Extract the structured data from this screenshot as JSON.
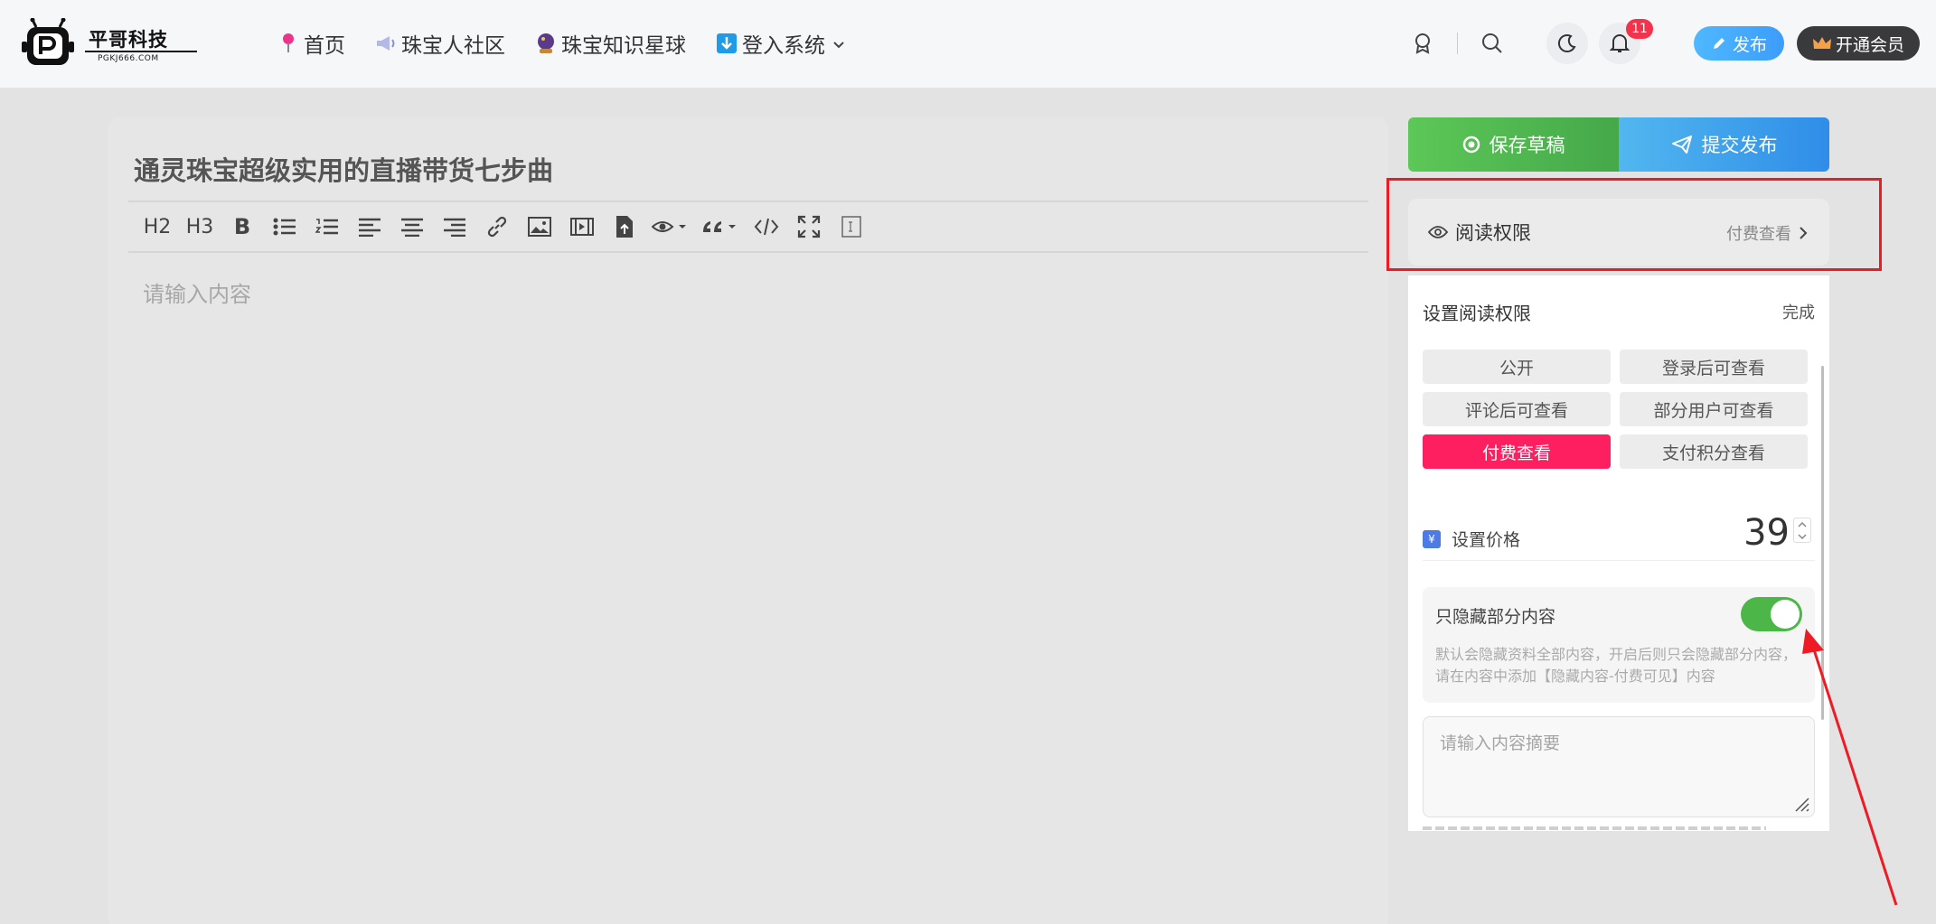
{
  "logo": {
    "name": "平哥科技",
    "sub": "PGKJ666.COM"
  },
  "nav": [
    {
      "label": "首页",
      "icon": "pin-icon"
    },
    {
      "label": "珠宝人社区",
      "icon": "megaphone-icon"
    },
    {
      "label": "珠宝知识星球",
      "icon": "crystal-ball-icon"
    },
    {
      "label": "登入系统",
      "icon": "download-arrow-icon"
    }
  ],
  "header": {
    "notification_count": "11",
    "publish_label": "发布",
    "vip_label": "开通会员"
  },
  "editor": {
    "title": "通灵珠宝超级实用的直播带货七步曲",
    "placeholder": "请输入内容",
    "toolbar": {
      "h2": "H2",
      "h3": "H3",
      "bold": "B"
    }
  },
  "actions": {
    "save_label": "保存草稿",
    "submit_label": "提交发布"
  },
  "read_permission": {
    "label": "阅读权限",
    "value": "付费查看",
    "panel_title": "设置阅读权限",
    "done_label": "完成",
    "options": [
      {
        "label": "公开",
        "active": false
      },
      {
        "label": "登录后可查看",
        "active": false
      },
      {
        "label": "评论后可查看",
        "active": false
      },
      {
        "label": "部分用户可查看",
        "active": false
      },
      {
        "label": "付费查看",
        "active": true
      },
      {
        "label": "支付积分查看",
        "active": false
      }
    ]
  },
  "price": {
    "label": "设置价格",
    "value": "39",
    "icon_text": "¥"
  },
  "hide_partial": {
    "title": "只隐藏部分内容",
    "enabled": true,
    "desc": "默认会隐藏资料全部内容，开启后则只会隐藏部分内容，请在内容中添加【隐藏内容-付费可见】内容"
  },
  "summary": {
    "placeholder": "请输入内容摘要"
  },
  "colors": {
    "accent_pink": "#fd1f60",
    "toggle_green": "#4cb748",
    "save_green": "#5cc857",
    "submit_blue": "#2f8de8",
    "annotation_red": "#ee1b24"
  }
}
